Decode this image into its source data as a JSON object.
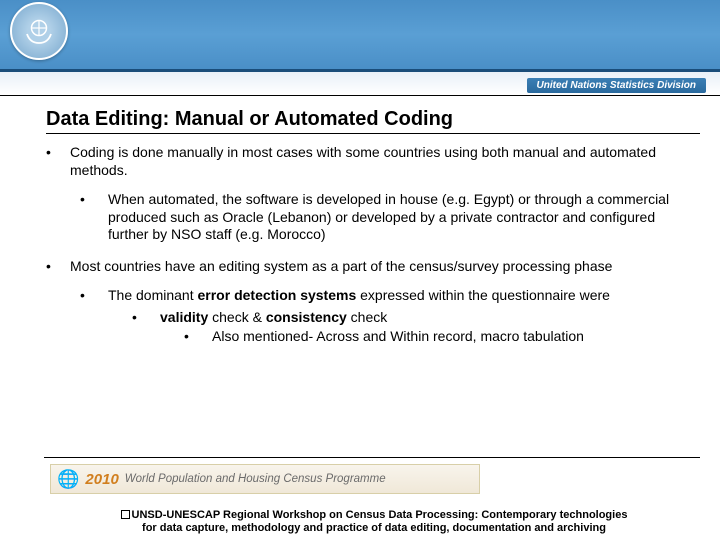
{
  "header": {
    "division": "United Nations Statistics Division"
  },
  "title": "Data Editing: Manual or Automated Coding",
  "bullets": {
    "b1": "Coding is done manually in most cases with some countries using both manual and automated methods.",
    "b1a": "When automated, the software is developed in house (e.g. Egypt) or through a commercial produced such as Oracle (Lebanon) or developed by a private contractor and configured further by NSO staff (e.g. Morocco)",
    "b2": "Most countries have an editing system as a part of the census/survey processing phase",
    "b2a_pre": "The dominant ",
    "b2a_strong": "error detection systems",
    "b2a_post": " expressed within the questionnaire were",
    "b2a_i_strong1": "validity",
    "b2a_i_mid": " check & ",
    "b2a_i_strong2": "consistency",
    "b2a_i_post": " check",
    "b2a_ii": "Also mentioned- Across and Within record, macro tabulation"
  },
  "census": {
    "year": "2010",
    "programme": "World Population and Housing Census Programme"
  },
  "footer": {
    "line1": "UNSD-UNESCAP Regional Workshop on Census Data Processing: Contemporary technologies",
    "line2": "for data capture, methodology and practice of data editing, documentation and archiving"
  }
}
